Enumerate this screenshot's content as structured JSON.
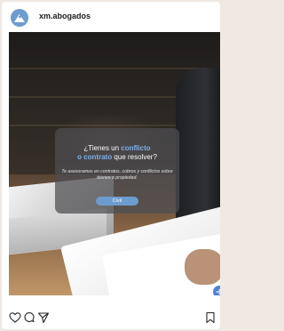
{
  "post": {
    "account": "xm.abogados",
    "overlay": {
      "line1_pre": "¿Tienes un ",
      "line1_highlight": "conflicto",
      "line2_highlight": "o contrato",
      "line2_post": " que resolver?",
      "subtext": "Te asesoramos en contratos, cobros y conflictos sobre bienes o propiedad.",
      "pill_label": "Civil"
    }
  },
  "colors": {
    "accent": "#6d9ccf",
    "highlight": "#7fb0e8",
    "carousel_button": "#4f82d8"
  },
  "icons": {
    "avatar": "mountain-logo-icon",
    "next": "chevron-right-icon",
    "like": "heart-icon",
    "comment": "comment-icon",
    "share": "send-icon",
    "save": "bookmark-icon"
  }
}
